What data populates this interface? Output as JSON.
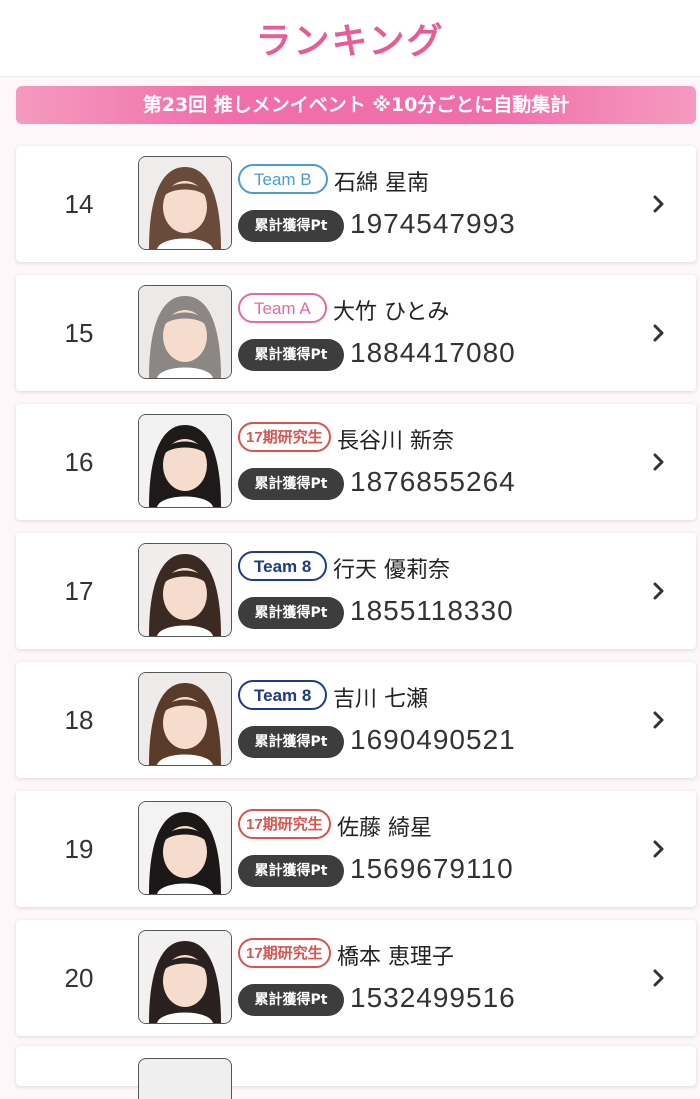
{
  "header": {
    "title": "ランキング"
  },
  "banner": {
    "text": "第23回 推しメンイベント ※10分ごとに自動集計"
  },
  "points_label": "累計獲得Pt",
  "rows": [
    {
      "rank": "14",
      "team": "Team B",
      "team_style": "blue",
      "name": "石綿 星南",
      "points": "1974547993",
      "hair": "#6a4a3a",
      "bg": "#f0ecec"
    },
    {
      "rank": "15",
      "team": "Team A",
      "team_style": "pink",
      "name": "大竹 ひとみ",
      "points": "1884417080",
      "hair": "#8a8784",
      "bg": "#eceae8"
    },
    {
      "rank": "16",
      "team": "17期研究生",
      "team_style": "red",
      "name": "長谷川 新奈",
      "points": "1876855264",
      "hair": "#1e1a1a",
      "bg": "#f2f2f2"
    },
    {
      "rank": "17",
      "team": "Team 8",
      "team_style": "navy",
      "name": "行天 優莉奈",
      "points": "1855118330",
      "hair": "#3a2a22",
      "bg": "#f1eded"
    },
    {
      "rank": "18",
      "team": "Team 8",
      "team_style": "navy",
      "name": "吉川 七瀬",
      "points": "1690490521",
      "hair": "#5a3a28",
      "bg": "#efebea"
    },
    {
      "rank": "19",
      "team": "17期研究生",
      "team_style": "red",
      "name": "佐藤 綺星",
      "points": "1569679110",
      "hair": "#1c1818",
      "bg": "#f3f3f3"
    },
    {
      "rank": "20",
      "team": "17期研究生",
      "team_style": "red",
      "name": "橋本 恵理子",
      "points": "1532499516",
      "hair": "#2a2020",
      "bg": "#f2f0f0"
    }
  ],
  "colors": {
    "accent_pink": "#ea5a96",
    "banner_pink": "#f06fa8",
    "team_b_blue": "#4a9bd6",
    "team_a_pink": "#e46aa6",
    "trainee_red": "#d9534f",
    "team_8_navy": "#1f3a8a"
  },
  "icons": {
    "row_arrow": "chevron-right-icon"
  }
}
